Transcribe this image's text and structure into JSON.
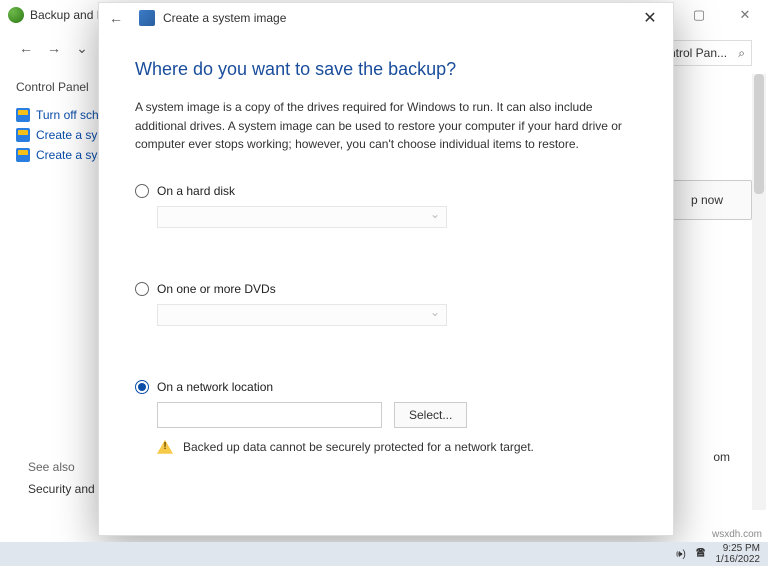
{
  "bg": {
    "title": "Backup and Re",
    "addr": "ntrol Pan...",
    "home": "Control Panel",
    "side_links": [
      "Turn off sched",
      "Create a syste",
      "Create a syste"
    ],
    "btn": "p now",
    "see_also_hdr": "See also",
    "see_also_link": "Security and M"
  },
  "dialog": {
    "title": "Create a system image",
    "heading": "Where do you want to save the backup?",
    "desc": "A system image is a copy of the drives required for Windows to run. It can also include additional drives. A system image can be used to restore your computer if your hard drive or computer ever stops working; however, you can't choose individual items to restore.",
    "opt_disk": "On a hard disk",
    "opt_dvd": "On one or more DVDs",
    "opt_net": "On a network location",
    "select_btn": "Select...",
    "net_value": "",
    "warning": "Backed up data cannot be securely protected for a network target."
  },
  "taskbar": {
    "time": "9:25 PM",
    "date": "1/16/2022"
  },
  "watermark": "wsxdh.com"
}
